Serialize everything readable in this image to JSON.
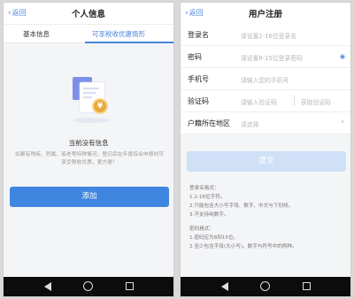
{
  "left": {
    "back_label": "返回",
    "title": "个人信息",
    "tabs": [
      {
        "label": "基本信息"
      },
      {
        "label": "可享税收优惠情形"
      }
    ],
    "empty_title": "当前没有信息",
    "empty_desc": "如果有残疾、烈属、孤老等特殊情况，登记后在年度综合申报时可享受税收优惠，更方便！",
    "add_button": "添加"
  },
  "right": {
    "back_label": "返回",
    "title": "用户注册",
    "fields": [
      {
        "label": "登录名",
        "placeholder": "请设置2-16位登录名"
      },
      {
        "label": "密码",
        "placeholder": "请设置8-15位登录密码"
      },
      {
        "label": "手机号",
        "placeholder": "请输入您的手机号"
      },
      {
        "label": "验证码",
        "placeholder": "请输入验证码",
        "action": "获取验证码"
      },
      {
        "label": "户籍所在地区",
        "placeholder": "请选择"
      }
    ],
    "submit_button": "提交",
    "rules": [
      "登录名格式：",
      "1.2-16位字符。",
      "2.只能包含大小写字母、数字、中文与下划线。",
      "3.不支持纯数字。",
      "",
      "密码格式：",
      "1.密码应为8到15位。",
      "2.至少包含字母(大小写)，数字与符号中的两种。"
    ]
  },
  "icons": {
    "eye": "eye-icon",
    "coin": "¥"
  },
  "colors": {
    "accent": "#3f86e0",
    "disabled": "#cfe0f7"
  }
}
